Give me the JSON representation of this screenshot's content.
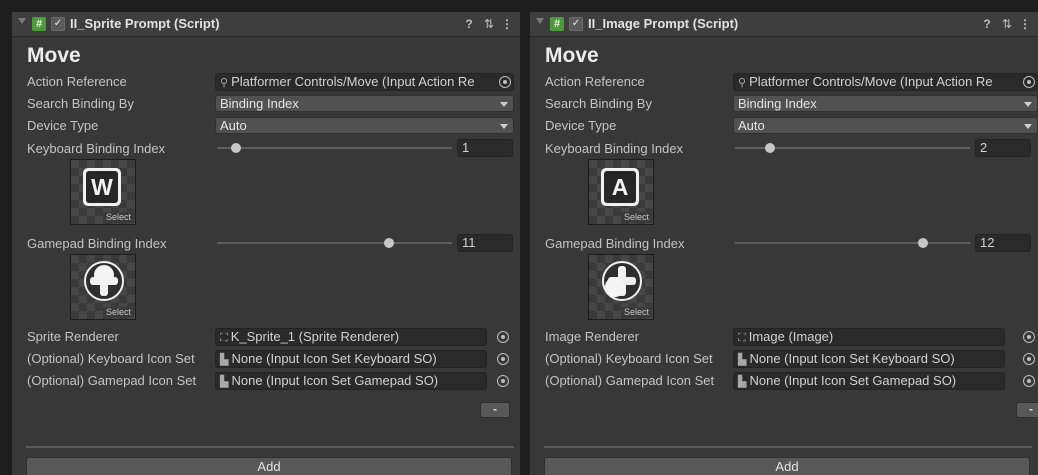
{
  "panels": [
    {
      "component_title": "II_Sprite Prompt (Script)",
      "section_title": "Move",
      "labels": {
        "action_reference": "Action Reference",
        "search_binding_by": "Search Binding By",
        "device_type": "Device Type",
        "keyboard_binding_index": "Keyboard Binding Index",
        "gamepad_binding_index": "Gamepad Binding Index",
        "renderer": "Sprite Renderer",
        "keyboard_icon_set": "(Optional) Keyboard Icon Set",
        "gamepad_icon_set": "(Optional) Gamepad Icon Set"
      },
      "values": {
        "action_reference": "Platformer Controls/Move (Input Action Re",
        "search_binding_by": "Binding Index",
        "device_type": "Auto",
        "keyboard_binding_index": "1",
        "gamepad_binding_index": "11",
        "renderer": "K_Sprite_1 (Sprite Renderer)",
        "keyboard_icon_set": "None (Input Icon Set Keyboard SO)",
        "gamepad_icon_set": "None (Input Icon Set Gamepad SO)"
      },
      "slider_fraction": {
        "keyboard": 0.08,
        "gamepad": 0.73
      },
      "keyboard_key_letter": "W",
      "thumb_select_label": "Select",
      "renderer_icon": "sprite-renderer-icon",
      "minus_label": "-",
      "add_label": "Add"
    },
    {
      "component_title": "II_Image Prompt (Script)",
      "section_title": "Move",
      "labels": {
        "action_reference": "Action Reference",
        "search_binding_by": "Search Binding By",
        "device_type": "Device Type",
        "keyboard_binding_index": "Keyboard Binding Index",
        "gamepad_binding_index": "Gamepad Binding Index",
        "renderer": "Image Renderer",
        "keyboard_icon_set": "(Optional) Keyboard Icon Set",
        "gamepad_icon_set": "(Optional) Gamepad Icon Set"
      },
      "values": {
        "action_reference": "Platformer Controls/Move (Input Action Re",
        "search_binding_by": "Binding Index",
        "device_type": "Auto",
        "keyboard_binding_index": "2",
        "gamepad_binding_index": "12",
        "renderer": "Image (Image)",
        "keyboard_icon_set": "None (Input Icon Set Keyboard SO)",
        "gamepad_icon_set": "None (Input Icon Set Gamepad SO)"
      },
      "slider_fraction": {
        "keyboard": 0.15,
        "gamepad": 0.8
      },
      "keyboard_key_letter": "A",
      "thumb_select_label": "Select",
      "renderer_icon": "image-icon",
      "minus_label": "-",
      "add_label": "Add"
    }
  ],
  "icons": {
    "fold": "foldout-arrow-icon",
    "script": "script-icon",
    "enabled_checkbox": "checkbox-checked-icon",
    "help": "help-icon",
    "preset": "preset-sliders-icon",
    "menu": "kebab-menu-icon",
    "object_picker": "object-picker-icon",
    "action_asset": "input-action-icon",
    "scriptable_object": "scriptable-object-icon"
  },
  "colors": {
    "panel_bg": "#383838",
    "field_bg": "#2a2a2a",
    "dropdown_bg": "#515151",
    "script_icon_green": "#4d9b3b"
  }
}
